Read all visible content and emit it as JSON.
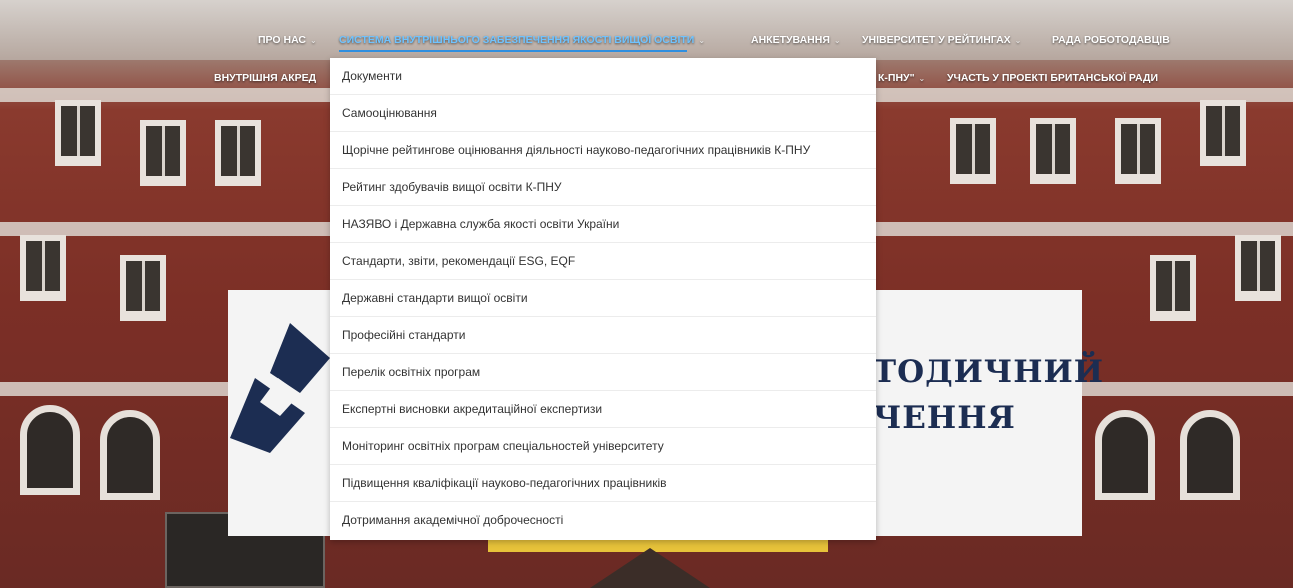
{
  "nav": {
    "row1": [
      {
        "label": "ПРО НАС",
        "chevron": true
      },
      {
        "label": "СИСТЕМА ВНУТРІШНЬОГО ЗАБЕЗПЕЧЕННЯ ЯКОСТІ ВИЩОЇ ОСВІТИ",
        "chevron": true,
        "active": true
      },
      {
        "label": "АНКЕТУВАННЯ",
        "chevron": true
      },
      {
        "label": "УНІВЕРСИТЕТ У РЕЙТИНГАХ",
        "chevron": true
      },
      {
        "label": "РАДА РОБОТОДАВЦІВ",
        "chevron": false
      }
    ],
    "row2": [
      {
        "label": "ВНУТРІШНЯ АКРЕД",
        "chevron": false
      },
      {
        "label": "К-ПНУ\"",
        "chevron": true
      },
      {
        "label": "УЧАСТЬ У ПРОЕКТІ БРИТАНСЬКОЇ РАДИ",
        "chevron": false
      }
    ],
    "chevron_glyph": "⌄"
  },
  "dropdown": {
    "items": [
      "Документи",
      "Самооцінювання",
      "Щорічне рейтингове оцінювання діяльності науково-педагогічних працівників К-ПНУ",
      "Рейтинг здобувачів вищої освіти К-ПНУ",
      "НАЗЯВО і Державна служба якості освіти України",
      "Стандарти, звіти, рекомендації ESG, EQF",
      "Державні стандарти вищої освіти",
      "Професійні стандарти",
      "Перелік освітніх програм",
      "Експертні висновки акредитаційної експертизи",
      "Моніторинг освітніх програм спеціальностей університету",
      "Підвищення кваліфікації науково-педагогічних працівників",
      "Дотримання академічної доброчесності"
    ]
  },
  "banner": {
    "line1": "ТОДИЧНИЙ",
    "line2": "ЧЕННЯ"
  },
  "colors": {
    "nav_text": "#ffffff",
    "nav_active": "#6fc3ff",
    "nav_underline": "#2f8fe0",
    "banner_title": "#1c2d52"
  }
}
